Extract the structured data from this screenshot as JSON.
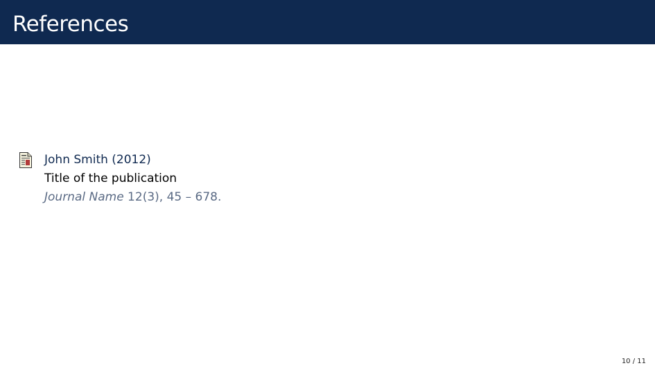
{
  "slide": {
    "title": "References"
  },
  "references": [
    {
      "icon": "article-icon",
      "author_year": "John Smith (2012)",
      "title": "Title of the publication",
      "journal": "Journal Name",
      "details": " 12(3), 45 – 678."
    }
  ],
  "footer": {
    "page_number": "10 / 11"
  },
  "colors": {
    "title_bar": "#0f2950",
    "title_text": "#ffffff",
    "author_text": "#0f2950",
    "journal_text": "#5a6a84"
  }
}
